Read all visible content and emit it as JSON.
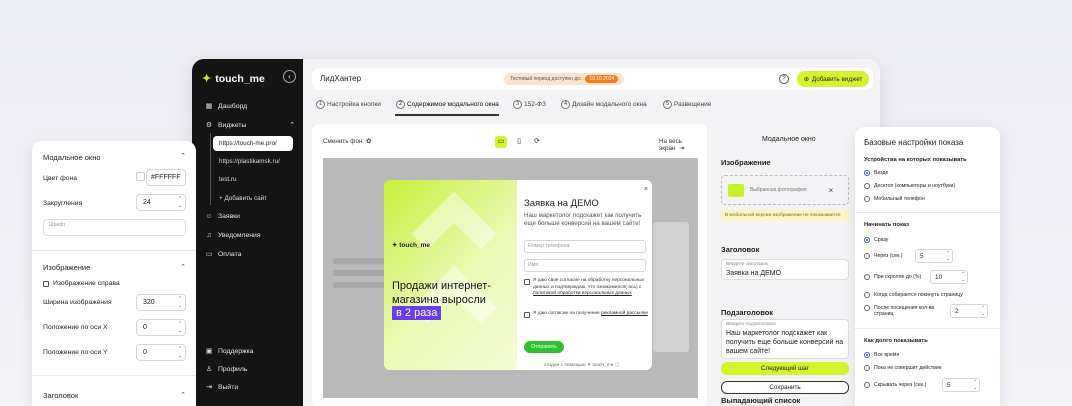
{
  "brand": {
    "logo": "touch_me",
    "accent": "#d6f22e",
    "sidebar_bg": "#141414"
  },
  "sidebar": {
    "items": [
      {
        "icon": "dashboard-icon",
        "label": "Дашборд"
      },
      {
        "icon": "widgets-icon",
        "label": "Виджеты"
      },
      {
        "icon": "requests-icon",
        "label": "Заявки"
      },
      {
        "icon": "bell-icon",
        "label": "Уведомления"
      },
      {
        "icon": "card-icon",
        "label": "Оплата"
      }
    ],
    "sites": [
      "https://touch-me.pro/",
      "https://plastikamsk.ru/",
      "test.ru"
    ],
    "add_site": "Добавить сайт",
    "bottom": [
      {
        "icon": "support-icon",
        "label": "Поддержка"
      },
      {
        "icon": "profile-icon",
        "label": "Профиль"
      },
      {
        "icon": "logout-icon",
        "label": "Выйти"
      }
    ]
  },
  "topbar": {
    "title": "ЛидХантер",
    "trial_text": "Тестовый период доступен до:",
    "trial_date": "19.10.2024",
    "add_widget": "Добавить виджет"
  },
  "steps": [
    {
      "n": "1",
      "label": "Настройка кнопки"
    },
    {
      "n": "2",
      "label": "Содержимое модального окна"
    },
    {
      "n": "3",
      "label": "152-ФЗ"
    },
    {
      "n": "4",
      "label": "Дизайн модального окна"
    },
    {
      "n": "5",
      "label": "Развещение"
    }
  ],
  "preview": {
    "change_bg": "Сменить фон",
    "fullscreen": "На весь экран"
  },
  "modal": {
    "logo": "touch_me",
    "headline": "Продажи интернет-магазина выросли",
    "highlight": "в 2 раза",
    "title": "Заявка на ДЕМО",
    "subtitle": "Наш маркетолог подскажет как получить еще больше конверсий на вашем сайте!",
    "phone_placeholder": "Номер телефона",
    "name_placeholder": "Имя",
    "consent1": "Я даю своё согласие на обработку персональных данных и подтверждаю, что ознакомился(-ась) с",
    "consent1_link": "политикой обработки персональных данных",
    "consent2": "Я даю согласие на получение",
    "consent2_link": "рекламной рассылки",
    "send": "Отправить",
    "made_by": "создан с помощью",
    "made_by_brand": "touch_me"
  },
  "settings": {
    "header": "Модальное окно",
    "image_section": "Изображение",
    "image_selected": "Выбранная фотография",
    "mobile_warning": "В мобильной версии изображение не показывается",
    "heading_section": "Заголовок",
    "heading_label": "Введите заголовок",
    "heading_value": "Заявка на ДЕМО",
    "subheading_section": "Подзаголовок",
    "subheading_label": "Введите подзаголовок",
    "subheading_value": "Наш маркетолог подскажет как получить еще больше конверсий на вашем сайте!",
    "next": "Следующий шаг",
    "save": "Сохранить",
    "dropdown_section": "Выпадающий список"
  },
  "left_card": {
    "title": "Модальное окно",
    "bg_color_label": "Цвет фона",
    "bg_color_value": "#FFFFFF",
    "radius_label": "Закругления",
    "radius_value": "24",
    "font_label": "Шрифт",
    "image_section": "Изображение",
    "image_right": "Изображение справа",
    "width_label": "Ширина изображения",
    "width_value": "320",
    "posx_label": "Положение по оси X",
    "posx_value": "0",
    "posy_label": "Положение по оси Y",
    "posy_value": "0",
    "heading_section": "Заголовок"
  },
  "right_card": {
    "title": "Базовые настройки показа",
    "devices_title": "Устройства на которых показывать",
    "devices": [
      "Везде",
      "Десктоп (компьютеры и ноутбуки)",
      "Мобильный телефон"
    ],
    "start_title": "Начинать показ",
    "start_now": "Сразу",
    "start_after": "Через (сек.)",
    "start_after_value": "5",
    "start_scroll": "При скролле до (%)",
    "start_scroll_value": "10",
    "start_leave": "Когда собирается покинуть страницу",
    "start_pages": "После посещения кол-ва страниц",
    "start_pages_value": "2",
    "duration_title": "Как долго показывать",
    "dur_always": "Все время",
    "dur_until": "Пока не совершит действие",
    "dur_hide": "Скрывать через (сек.)",
    "dur_hide_value": "5"
  }
}
